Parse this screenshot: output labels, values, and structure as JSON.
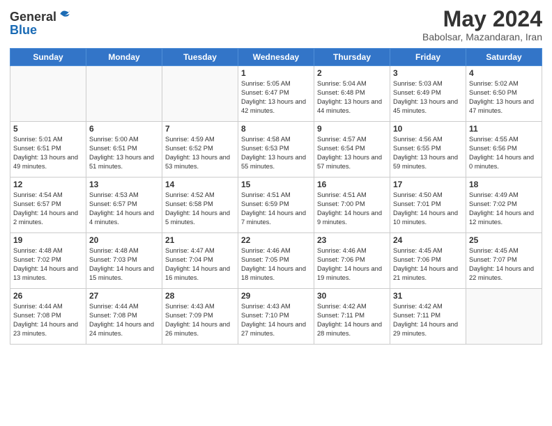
{
  "header": {
    "logo_line1": "General",
    "logo_line2": "Blue",
    "month": "May 2024",
    "location": "Babolsar, Mazandaran, Iran"
  },
  "days_of_week": [
    "Sunday",
    "Monday",
    "Tuesday",
    "Wednesday",
    "Thursday",
    "Friday",
    "Saturday"
  ],
  "weeks": [
    [
      {
        "day": "",
        "empty": true
      },
      {
        "day": "",
        "empty": true
      },
      {
        "day": "",
        "empty": true
      },
      {
        "day": "1",
        "sunrise": "5:05 AM",
        "sunset": "6:47 PM",
        "daylight": "13 hours and 42 minutes."
      },
      {
        "day": "2",
        "sunrise": "5:04 AM",
        "sunset": "6:48 PM",
        "daylight": "13 hours and 44 minutes."
      },
      {
        "day": "3",
        "sunrise": "5:03 AM",
        "sunset": "6:49 PM",
        "daylight": "13 hours and 45 minutes."
      },
      {
        "day": "4",
        "sunrise": "5:02 AM",
        "sunset": "6:50 PM",
        "daylight": "13 hours and 47 minutes."
      }
    ],
    [
      {
        "day": "5",
        "sunrise": "5:01 AM",
        "sunset": "6:51 PM",
        "daylight": "13 hours and 49 minutes."
      },
      {
        "day": "6",
        "sunrise": "5:00 AM",
        "sunset": "6:51 PM",
        "daylight": "13 hours and 51 minutes."
      },
      {
        "day": "7",
        "sunrise": "4:59 AM",
        "sunset": "6:52 PM",
        "daylight": "13 hours and 53 minutes."
      },
      {
        "day": "8",
        "sunrise": "4:58 AM",
        "sunset": "6:53 PM",
        "daylight": "13 hours and 55 minutes."
      },
      {
        "day": "9",
        "sunrise": "4:57 AM",
        "sunset": "6:54 PM",
        "daylight": "13 hours and 57 minutes."
      },
      {
        "day": "10",
        "sunrise": "4:56 AM",
        "sunset": "6:55 PM",
        "daylight": "13 hours and 59 minutes."
      },
      {
        "day": "11",
        "sunrise": "4:55 AM",
        "sunset": "6:56 PM",
        "daylight": "14 hours and 0 minutes."
      }
    ],
    [
      {
        "day": "12",
        "sunrise": "4:54 AM",
        "sunset": "6:57 PM",
        "daylight": "14 hours and 2 minutes."
      },
      {
        "day": "13",
        "sunrise": "4:53 AM",
        "sunset": "6:57 PM",
        "daylight": "14 hours and 4 minutes."
      },
      {
        "day": "14",
        "sunrise": "4:52 AM",
        "sunset": "6:58 PM",
        "daylight": "14 hours and 5 minutes."
      },
      {
        "day": "15",
        "sunrise": "4:51 AM",
        "sunset": "6:59 PM",
        "daylight": "14 hours and 7 minutes."
      },
      {
        "day": "16",
        "sunrise": "4:51 AM",
        "sunset": "7:00 PM",
        "daylight": "14 hours and 9 minutes."
      },
      {
        "day": "17",
        "sunrise": "4:50 AM",
        "sunset": "7:01 PM",
        "daylight": "14 hours and 10 minutes."
      },
      {
        "day": "18",
        "sunrise": "4:49 AM",
        "sunset": "7:02 PM",
        "daylight": "14 hours and 12 minutes."
      }
    ],
    [
      {
        "day": "19",
        "sunrise": "4:48 AM",
        "sunset": "7:02 PM",
        "daylight": "14 hours and 13 minutes."
      },
      {
        "day": "20",
        "sunrise": "4:48 AM",
        "sunset": "7:03 PM",
        "daylight": "14 hours and 15 minutes."
      },
      {
        "day": "21",
        "sunrise": "4:47 AM",
        "sunset": "7:04 PM",
        "daylight": "14 hours and 16 minutes."
      },
      {
        "day": "22",
        "sunrise": "4:46 AM",
        "sunset": "7:05 PM",
        "daylight": "14 hours and 18 minutes."
      },
      {
        "day": "23",
        "sunrise": "4:46 AM",
        "sunset": "7:06 PM",
        "daylight": "14 hours and 19 minutes."
      },
      {
        "day": "24",
        "sunrise": "4:45 AM",
        "sunset": "7:06 PM",
        "daylight": "14 hours and 21 minutes."
      },
      {
        "day": "25",
        "sunrise": "4:45 AM",
        "sunset": "7:07 PM",
        "daylight": "14 hours and 22 minutes."
      }
    ],
    [
      {
        "day": "26",
        "sunrise": "4:44 AM",
        "sunset": "7:08 PM",
        "daylight": "14 hours and 23 minutes."
      },
      {
        "day": "27",
        "sunrise": "4:44 AM",
        "sunset": "7:08 PM",
        "daylight": "14 hours and 24 minutes."
      },
      {
        "day": "28",
        "sunrise": "4:43 AM",
        "sunset": "7:09 PM",
        "daylight": "14 hours and 26 minutes."
      },
      {
        "day": "29",
        "sunrise": "4:43 AM",
        "sunset": "7:10 PM",
        "daylight": "14 hours and 27 minutes."
      },
      {
        "day": "30",
        "sunrise": "4:42 AM",
        "sunset": "7:11 PM",
        "daylight": "14 hours and 28 minutes."
      },
      {
        "day": "31",
        "sunrise": "4:42 AM",
        "sunset": "7:11 PM",
        "daylight": "14 hours and 29 minutes."
      },
      {
        "day": "",
        "empty": true
      }
    ]
  ]
}
